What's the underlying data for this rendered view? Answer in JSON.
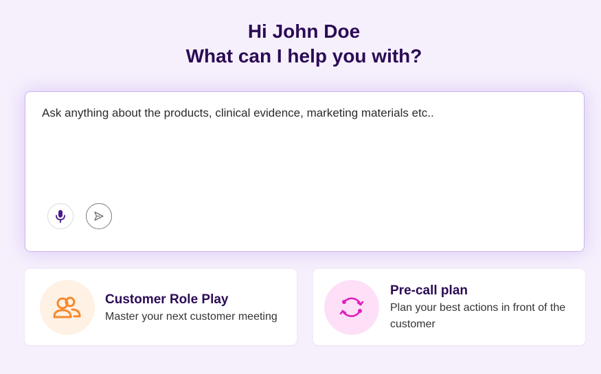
{
  "greeting": {
    "line1": "Hi John Doe",
    "line2": "What can I help you with?"
  },
  "prompt": {
    "placeholder": "Ask anything about the products, clinical evidence, marketing materials etc..",
    "mic_icon": "microphone-icon",
    "send_icon": "send-icon"
  },
  "cards": [
    {
      "title": "Customer Role Play",
      "description": "Master your next customer meeting",
      "icon": "users-icon",
      "accent": "#f5892b"
    },
    {
      "title": "Pre-call plan",
      "description": "Plan your best actions in front of the customer",
      "icon": "refresh-cycle-icon",
      "accent": "#e01fbf"
    }
  ],
  "colors": {
    "heading": "#2b0b55",
    "background": "#f6f0fc",
    "mic_accent": "#4a1a8c"
  }
}
